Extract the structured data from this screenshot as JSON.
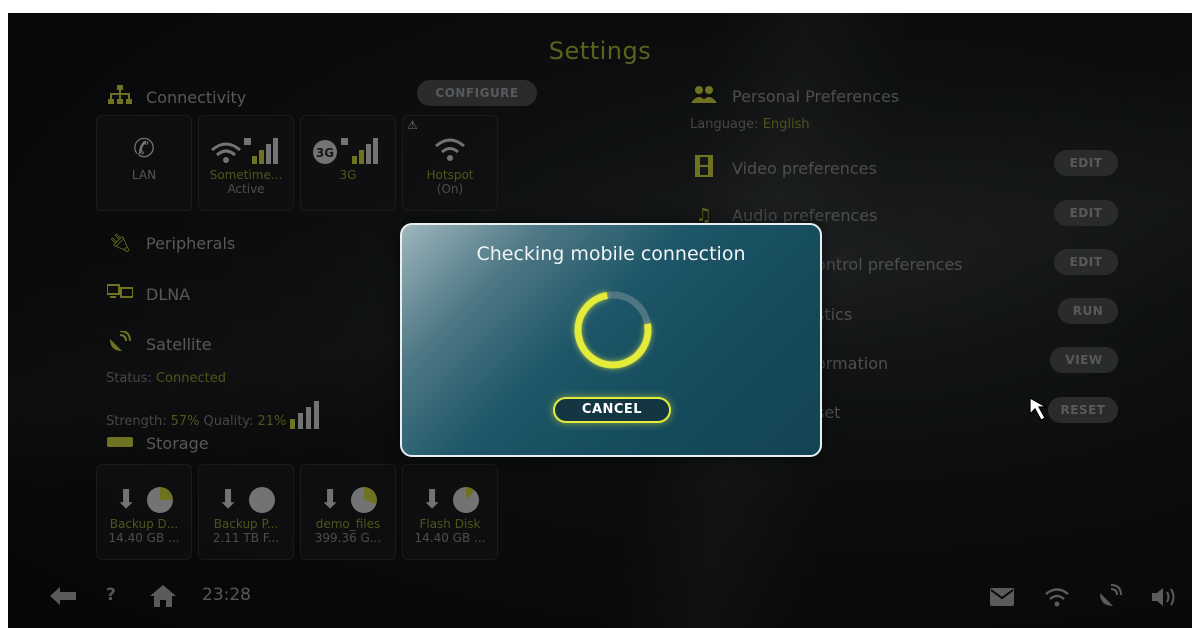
{
  "page_title": "Settings",
  "connectivity": {
    "heading": "Connectivity",
    "configure_label": "CONFIGURE",
    "tiles": [
      {
        "name": "LAN",
        "line1": "LAN",
        "line2": ""
      },
      {
        "name": "wifi",
        "line1": "Sometime...",
        "line2": "Active"
      },
      {
        "name": "3g",
        "line1": "3G",
        "line2": "",
        "badge": "3G"
      },
      {
        "name": "hotspot",
        "line1": "Hotspot",
        "line2": "(On)"
      }
    ]
  },
  "peripherals": {
    "heading": "Peripherals"
  },
  "dlna": {
    "heading": "DLNA"
  },
  "satellite": {
    "heading": "Satellite",
    "status_label": "Status:",
    "status_value": "Connected",
    "strength_label": "Strength:",
    "strength_value": "57%",
    "quality_label": "Quality:",
    "quality_value": "21%"
  },
  "storage": {
    "heading": "Storage",
    "tiles": [
      {
        "line1": "Backup D...",
        "line2": "14.40 GB ..."
      },
      {
        "line1": "Backup P...",
        "line2": "2.11 TB F..."
      },
      {
        "line1": "demo_files",
        "line2": "399.36 G..."
      },
      {
        "line1": "Flash Disk",
        "line2": "14.40 GB ..."
      }
    ]
  },
  "personal": {
    "heading": "Personal Preferences",
    "language_label": "Language:",
    "language_value": "English"
  },
  "right_rows": [
    {
      "label": "Video preferences",
      "button": "EDIT"
    },
    {
      "label": "Audio preferences",
      "button": "EDIT"
    },
    {
      "label": "ontrol preferences",
      "button": "EDIT"
    },
    {
      "label": "stics",
      "button": "RUN"
    },
    {
      "label": "ormation",
      "button": "VIEW"
    },
    {
      "label": "set",
      "button": "RESET"
    }
  ],
  "bottom_bar": {
    "help": "?",
    "time": "23:28"
  },
  "dialog": {
    "title": "Checking mobile connection",
    "cancel_label": "CANCEL"
  },
  "colors": {
    "accent": "#e4ec3b",
    "dialog_bg": "#154b5c"
  }
}
